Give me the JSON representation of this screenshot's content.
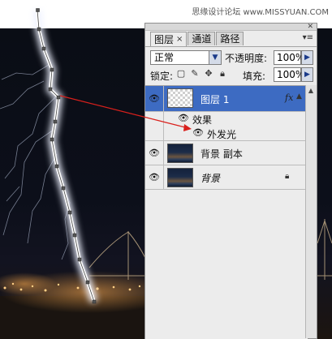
{
  "watermark": "思缘设计论坛 www.MISSYUAN.COM",
  "panel": {
    "tabs": [
      {
        "label": "图层",
        "close": "×"
      },
      {
        "label": "通道"
      },
      {
        "label": "路径"
      }
    ],
    "blend_mode": "正常",
    "opacity_label": "不透明度:",
    "opacity_value": "100%",
    "lock_label": "锁定:",
    "fill_label": "填充:",
    "fill_value": "100%",
    "layers": [
      {
        "name": "图层 1",
        "fx": "fx",
        "selected": true
      },
      {
        "name": "效果"
      },
      {
        "name": "外发光"
      },
      {
        "name": "背景 副本"
      },
      {
        "name": "背景",
        "locked": true
      }
    ]
  },
  "colors": {
    "selection": "#3d6bc2",
    "annotation_arrow": "#d9201c"
  }
}
